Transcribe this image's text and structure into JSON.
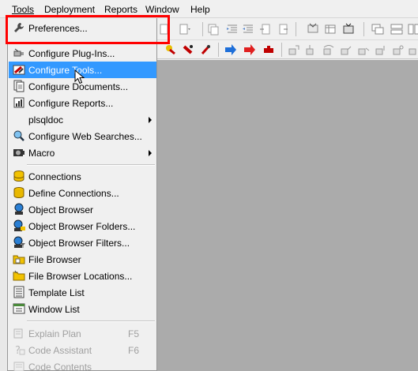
{
  "menubar": {
    "items": [
      "Tools",
      "Deployment",
      "Reports",
      "Window",
      "Help"
    ]
  },
  "menu": {
    "items": [
      {
        "label": "Preferences...",
        "icon": "wrench-icon"
      },
      {
        "label": "Configure Plug-Ins...",
        "icon": "plugin-icon"
      },
      {
        "label": "Configure Tools...",
        "icon": "tools-icon"
      },
      {
        "label": "Configure Documents...",
        "icon": "documents-icon"
      },
      {
        "label": "Configure Reports...",
        "icon": "reports-icon"
      },
      {
        "label": "plsqldoc",
        "submenu": true
      },
      {
        "label": "Configure Web Searches...",
        "icon": "magnifier-icon"
      },
      {
        "label": "Macro",
        "icon": "macro-icon",
        "submenu": true
      },
      {
        "label": "Connections",
        "icon": "database-icon"
      },
      {
        "label": "Define Connections...",
        "icon": "define-connections-icon"
      },
      {
        "label": "Object Browser",
        "icon": "object-browser-icon"
      },
      {
        "label": "Object Browser Folders...",
        "icon": "object-browser-folders-icon"
      },
      {
        "label": "Object Browser Filters...",
        "icon": "object-browser-filters-icon"
      },
      {
        "label": "File Browser",
        "icon": "file-browser-icon"
      },
      {
        "label": "File Browser Locations...",
        "icon": "file-browser-locations-icon"
      },
      {
        "label": "Template List",
        "icon": "template-list-icon"
      },
      {
        "label": "Window List",
        "icon": "window-list-icon"
      },
      {
        "label": "Explain Plan",
        "shortcut": "F5",
        "disabled": true,
        "icon": "explain-plan-icon"
      },
      {
        "label": "Code Assistant",
        "shortcut": "F6",
        "disabled": true,
        "icon": "code-assistant-icon"
      },
      {
        "label": "Code Contents",
        "disabled": true,
        "icon": "code-contents-icon"
      }
    ],
    "highlighted_index": 2
  },
  "colors": {
    "highlight": "#3399ff",
    "annotation": "#ff0000",
    "workspace": "#ababab"
  }
}
